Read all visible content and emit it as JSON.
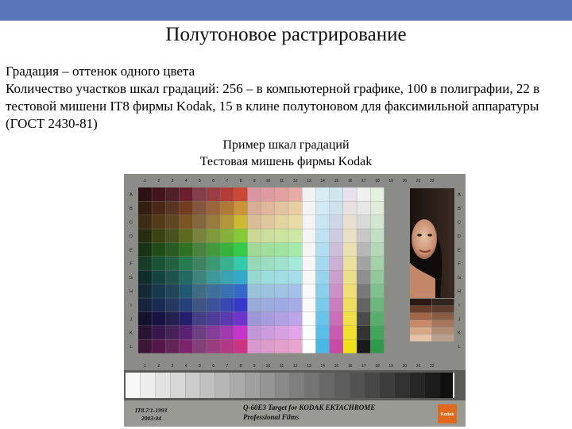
{
  "header": {
    "bar_color": "#5b76b8"
  },
  "title": "Полутоновое растрирование",
  "body": {
    "line1": "Градация – оттенок одного цвета",
    "line2": "Количество участков шкал градаций: 256 – в компьютерной графике, 100 в полиграфии, 22 в тестовой мишени IT8 фирмы Kodak, 15 в клине полутоновом для факсимильной аппаратуры (ГОСТ 2430-81)"
  },
  "caption": {
    "line1": "Пример шкал градаций",
    "line2": "Тестовая мишень фирмы Kodak"
  },
  "target": {
    "column_numbers": [
      "1",
      "2",
      "3",
      "4",
      "5",
      "6",
      "7",
      "8",
      "9",
      "10",
      "11",
      "12",
      "13",
      "14",
      "15",
      "16",
      "17",
      "18",
      "19",
      "20",
      "21",
      "22"
    ],
    "row_letters": [
      "A",
      "B",
      "C",
      "D",
      "E",
      "F",
      "G",
      "H",
      "I",
      "J",
      "K",
      "L"
    ],
    "id_line1": "IT8.7/1-1993",
    "id_line2": "2003:04",
    "product_line1": "Q-60E3 Target for KODAK EKTACHROME",
    "product_line2": "Professional Films",
    "logo_text": "Kodak",
    "logo_color": "#e06a1b",
    "gray_scale_steps": 22
  }
}
